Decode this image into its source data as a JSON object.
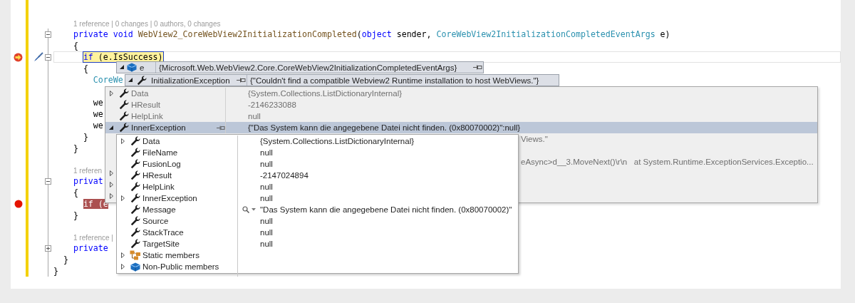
{
  "editor": {
    "lines": [
      {
        "kind": "lens",
        "text": "1 reference | 0 changes | 0 authors, 0 changes"
      },
      {
        "kind": "code",
        "fold_expanded": true,
        "tokens": [
          {
            "kind": "kw",
            "s": "    private"
          },
          {
            "kind": "kw",
            "s": " void"
          },
          {
            "kind": "method",
            "s": " WebView2_CoreWebView2InitializationCompleted"
          },
          {
            "kind": "plain",
            "s": "("
          },
          {
            "kind": "kw",
            "s": "object"
          },
          {
            "kind": "plain",
            "s": " sender,"
          },
          {
            "kind": "type",
            "s": " CoreWebView2InitializationCompletedEventArgs"
          },
          {
            "kind": "plain",
            "s": " e)"
          }
        ]
      },
      {
        "kind": "code",
        "tokens": [
          {
            "kind": "plain",
            "s": "    {"
          }
        ]
      },
      {
        "kind": "code",
        "current_statement": true,
        "quick_action": true,
        "fold_expanded": true,
        "tokens": [
          {
            "kind": "kw",
            "s": "      if"
          },
          {
            "kind": "plain",
            "s": " (e.IsSuccess)"
          }
        ]
      },
      {
        "kind": "code",
        "tokens": [
          {
            "kind": "plain",
            "s": "      {"
          }
        ]
      },
      {
        "kind": "code",
        "tokens": [
          {
            "kind": "type",
            "s": "        CoreWe"
          }
        ]
      },
      {
        "kind": "blank"
      },
      {
        "kind": "code",
        "tokens": [
          {
            "kind": "plain",
            "s": "        we"
          }
        ]
      },
      {
        "kind": "code",
        "tokens": [
          {
            "kind": "plain",
            "s": "        we"
          }
        ]
      },
      {
        "kind": "code",
        "tokens": [
          {
            "kind": "plain",
            "s": "        we"
          }
        ]
      },
      {
        "kind": "code",
        "tokens": [
          {
            "kind": "plain",
            "s": "      }"
          }
        ]
      },
      {
        "kind": "code",
        "tokens": [
          {
            "kind": "plain",
            "s": "    }"
          }
        ]
      },
      {
        "kind": "blank"
      },
      {
        "kind": "lens",
        "text": "1 referen"
      },
      {
        "kind": "code",
        "fold_expanded": true,
        "tokens": [
          {
            "kind": "kw",
            "s": "    privat"
          }
        ]
      },
      {
        "kind": "code",
        "tokens": [
          {
            "kind": "plain",
            "s": "    {"
          }
        ]
      },
      {
        "kind": "code",
        "breakpoint": true,
        "tokens": [
          {
            "kind": "plain",
            "s": "      if (e"
          }
        ]
      },
      {
        "kind": "code",
        "tokens": [
          {
            "kind": "plain",
            "s": "    }"
          }
        ]
      },
      {
        "kind": "blank"
      },
      {
        "kind": "lens",
        "text": "1 reference |"
      },
      {
        "kind": "code",
        "fold_expanded": false,
        "tokens": [
          {
            "kind": "kw",
            "s": "    private"
          }
        ]
      },
      {
        "kind": "code",
        "tokens": [
          {
            "kind": "plain",
            "s": "  }"
          }
        ]
      },
      {
        "kind": "code",
        "tokens": [
          {
            "kind": "plain",
            "s": "}"
          }
        ]
      }
    ]
  },
  "datatips": [
    {
      "name": "e",
      "value": "{Microsoft.Web.WebView2.Core.CoreWebView2InitializationCompletedEventArgs}",
      "expanded": true
    },
    {
      "name": "InitializationException",
      "value": "{\"Couldn't find a compatible Webview2 Runtime installation to host WebViews.\"}",
      "expanded": true
    }
  ],
  "exception_panel": {
    "rows": [
      {
        "name": "Data",
        "value": "{System.Collections.ListDictionaryInternal}",
        "expandable": true,
        "expanded": false,
        "selected": false
      },
      {
        "name": "HResult",
        "value": "-2146233088",
        "expandable": false,
        "selected": false
      },
      {
        "name": "HelpLink",
        "value": "null",
        "expandable": false,
        "selected": false
      },
      {
        "name": "InnerException",
        "value": "{\"Das System kann die angegebene Datei nicht finden. (0x80070002)\":null}",
        "expandable": true,
        "expanded": true,
        "selected": true
      }
    ],
    "covered_rows": [
      {
        "expandable": false,
        "value": "Views.\""
      },
      {
        "expandable": false
      },
      {
        "expandable": false,
        "value": "eAsync>d__3.MoveNext()\\r\\n   at System.Runtime.ExceptionServices.Exceptio..."
      },
      {
        "expandable": true,
        "expanded": false
      },
      {
        "expandable": true,
        "expanded": false
      },
      {
        "expandable": true,
        "expanded": false
      }
    ]
  },
  "inner_exception": {
    "rows": [
      {
        "kind": "property",
        "name": "Data",
        "value": "{System.Collections.ListDictionaryInternal}",
        "expandable": true,
        "expanded": false
      },
      {
        "kind": "property",
        "name": "FileName",
        "value": "null",
        "expandable": false
      },
      {
        "kind": "property",
        "name": "FusionLog",
        "value": "null",
        "expandable": false
      },
      {
        "kind": "property",
        "name": "HResult",
        "value": "-2147024894",
        "expandable": false
      },
      {
        "kind": "property",
        "name": "HelpLink",
        "value": "null",
        "expandable": false
      },
      {
        "kind": "property",
        "name": "InnerException",
        "value": "null",
        "expandable": true,
        "expanded": false
      },
      {
        "kind": "property",
        "name": "Message",
        "value": "\"Das System kann die angegebene Datei nicht finden. (0x80070002)\"",
        "expandable": false,
        "visualizer": true
      },
      {
        "kind": "property",
        "name": "Source",
        "value": "null",
        "expandable": false
      },
      {
        "kind": "property",
        "name": "StackTrace",
        "value": "null",
        "expandable": false
      },
      {
        "kind": "property",
        "name": "TargetSite",
        "value": "null",
        "expandable": false
      },
      {
        "kind": "static",
        "name": "Static members",
        "expandable": true,
        "expanded": false
      },
      {
        "kind": "nonpublic",
        "name": "Non-Public members",
        "expandable": true,
        "expanded": false
      }
    ]
  }
}
